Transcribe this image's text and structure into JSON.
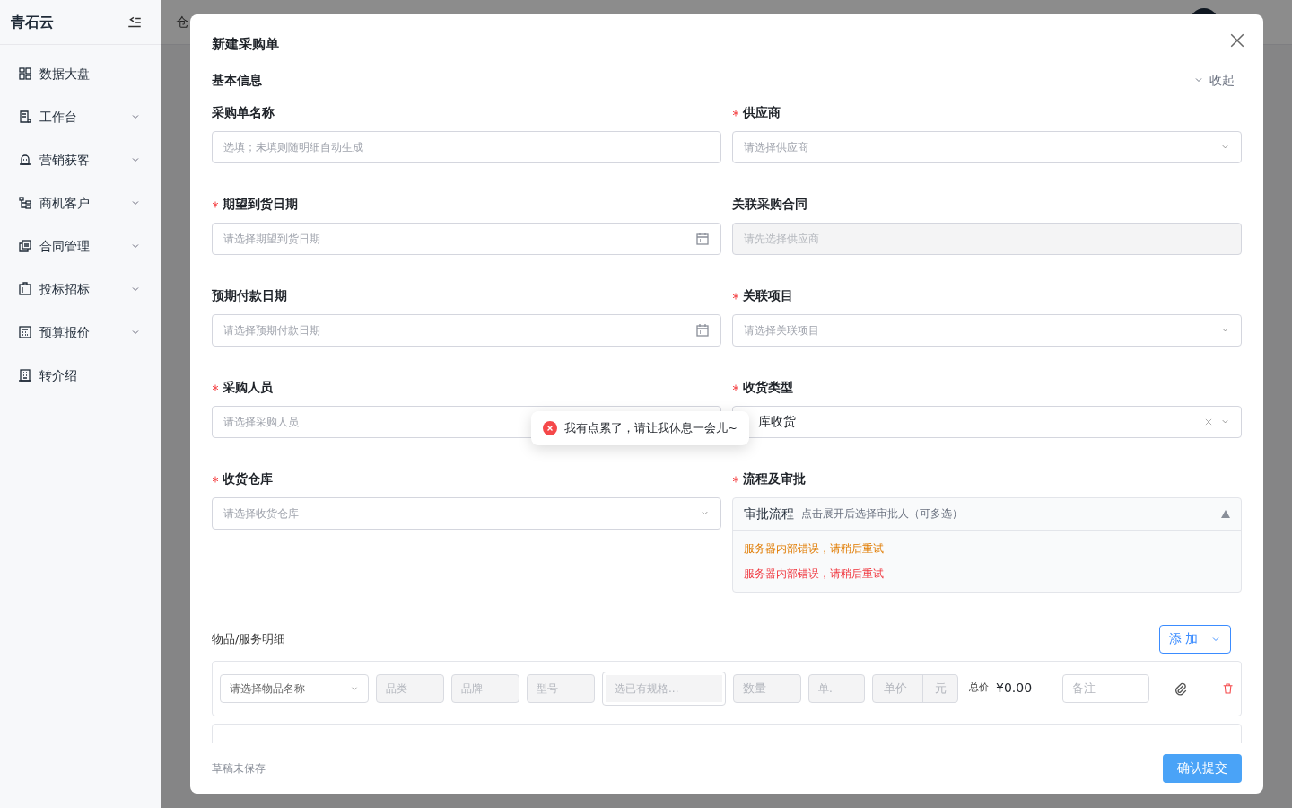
{
  "sidebar": {
    "brand": "青石云",
    "items": [
      {
        "label": "数据大盘",
        "expandable": false
      },
      {
        "label": "工作台",
        "expandable": true
      },
      {
        "label": "营销获客",
        "expandable": true
      },
      {
        "label": "商机客户",
        "expandable": true
      },
      {
        "label": "合同管理",
        "expandable": true
      },
      {
        "label": "投标招标",
        "expandable": true
      },
      {
        "label": "预算报价",
        "expandable": true
      },
      {
        "label": "转介绍",
        "expandable": false
      }
    ]
  },
  "background": {
    "breadcrumb": "仓"
  },
  "modal": {
    "title": "新建采购单",
    "section": "基本信息",
    "collapse": "收起",
    "fields": [
      {
        "label": "采购单名称",
        "required": false,
        "kind": "input",
        "placeholder": "选填；未填则随明细自动生成"
      },
      {
        "label": "供应商",
        "required": true,
        "kind": "select",
        "placeholder": "请选择供应商"
      },
      {
        "label": "期望到货日期",
        "required": true,
        "kind": "date",
        "placeholder": "请选择期望到货日期"
      },
      {
        "label": "关联采购合同",
        "required": false,
        "kind": "disabled",
        "placeholder": "请先选择供应商"
      },
      {
        "label": "预期付款日期",
        "required": false,
        "kind": "date",
        "placeholder": "请选择预期付款日期"
      },
      {
        "label": "关联项目",
        "required": true,
        "kind": "select",
        "placeholder": "请选择关联项目"
      },
      {
        "label": "采购人员",
        "required": true,
        "kind": "input",
        "placeholder": "请选择采购人员"
      },
      {
        "label": "收货类型",
        "required": true,
        "kind": "filled",
        "value": "库收货"
      },
      {
        "label": "收货仓库",
        "required": true,
        "kind": "select",
        "placeholder": "请选择收货仓库"
      },
      {
        "label": "流程及审批",
        "required": true,
        "kind": "approval",
        "title": "审批流程",
        "hint": "点击展开后选择审批人（可多选）",
        "expanded": true,
        "messages": [
          {
            "text": "服务器内部错误，请稍后重试",
            "kind": "warning"
          },
          {
            "text": "服务器内部错误，请稍后重试",
            "kind": "error"
          }
        ]
      }
    ],
    "items_title": "物品/服务明细",
    "add_button": "添 加",
    "items": [
      {
        "name": "请选择物品名称",
        "category": "品类",
        "brand": "品牌",
        "model": "型号",
        "spec": "选已有规格...",
        "qty": "数量",
        "unit": "单.",
        "price": "单价",
        "currency": "元",
        "total_label": "总价",
        "total": "¥0.00",
        "note": "备注"
      }
    ],
    "draft_status": "草稿未保存",
    "submit": "确认提交"
  },
  "toast": {
    "kind": "error",
    "text": "我有点累了，请让我休息一会儿~"
  }
}
